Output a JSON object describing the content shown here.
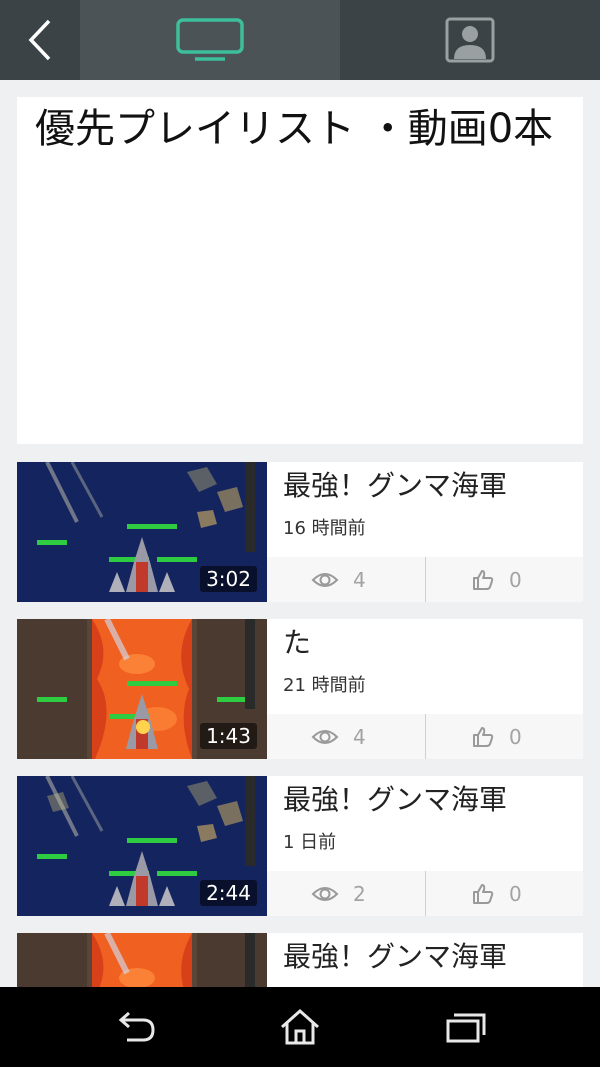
{
  "topbar": {
    "back_icon": "chevron-left-icon",
    "tv_icon": "tv-icon",
    "user_icon": "user-profile-icon",
    "accent": "#3dbf9b"
  },
  "playlist": {
    "title": "優先プレイリスト ・動画0本"
  },
  "videos": [
    {
      "title": "最強！グンマ海軍",
      "time": "16 時間前",
      "duration": "3:02",
      "views": "4",
      "likes": "0",
      "theme": "space"
    },
    {
      "title": "た",
      "time": "21 時間前",
      "duration": "1:43",
      "views": "4",
      "likes": "0",
      "theme": "lava"
    },
    {
      "title": "最強！グンマ海軍",
      "time": "1 日前",
      "duration": "2:44",
      "views": "2",
      "likes": "0",
      "theme": "space"
    },
    {
      "title": "最強！グンマ海軍",
      "time": "",
      "duration": "",
      "views": "",
      "likes": "",
      "theme": "lava"
    }
  ],
  "navbar": {
    "back_icon": "back-arrow-icon",
    "home_icon": "home-icon",
    "recents_icon": "recent-apps-icon"
  }
}
